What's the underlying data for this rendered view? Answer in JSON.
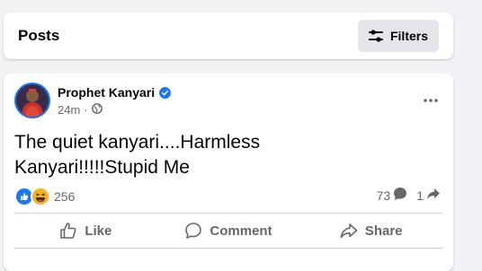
{
  "posts_header": {
    "title": "Posts",
    "filters_label": "Filters"
  },
  "post": {
    "author": "Prophet Kanyari",
    "verified": true,
    "time": "24m",
    "visibility_icon": "globe-icon",
    "text_line1": "The quiet kanyari....Harmless",
    "text_line2": "Kanyari!!!!!Stupid Me",
    "reaction_icons": [
      "like-reaction-icon",
      "haha-reaction-icon"
    ],
    "reactions_count": "256",
    "comments_count": "73",
    "shares_count": "1",
    "actions": {
      "like": "Like",
      "comment": "Comment",
      "share": "Share"
    }
  },
  "colors": {
    "background": "#f0f2f5",
    "card": "#ffffff",
    "accent_blue": "#1877f2",
    "secondary_text": "#65676b",
    "haha_yellow": "#f7b125"
  }
}
